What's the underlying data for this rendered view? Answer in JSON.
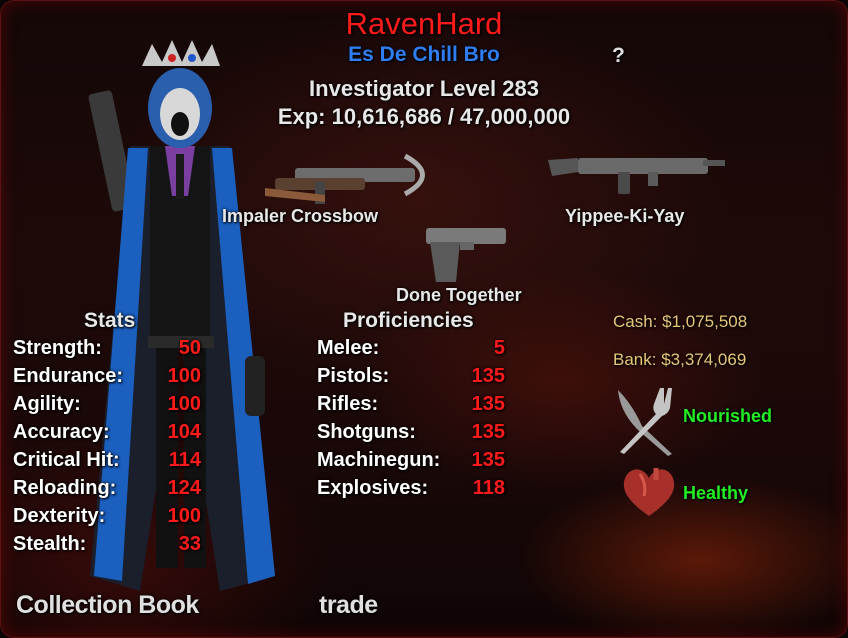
{
  "profile": {
    "name": "RavenHard",
    "title": "Es De Chill Bro",
    "level_text": "Investigator Level 283",
    "exp_text": "Exp: 10,616,686 / 47,000,000",
    "help": "?"
  },
  "weapons": {
    "primary": "Impaler Crossbow",
    "secondary": "Yippee-Ki-Yay",
    "sidearm": "Done Together"
  },
  "stats": {
    "header": "Stats",
    "rows": [
      {
        "label": "Strength:",
        "value": "50"
      },
      {
        "label": "Endurance:",
        "value": "100"
      },
      {
        "label": "Agility:",
        "value": "100"
      },
      {
        "label": "Accuracy:",
        "value": "104"
      },
      {
        "label": "Critical Hit:",
        "value": "114"
      },
      {
        "label": "Reloading:",
        "value": "124"
      },
      {
        "label": "Dexterity:",
        "value": "100"
      },
      {
        "label": "Stealth:",
        "value": "33"
      }
    ]
  },
  "proficiencies": {
    "header": "Proficiencies",
    "rows": [
      {
        "label": "Melee:",
        "value": "5"
      },
      {
        "label": "Pistols:",
        "value": "135"
      },
      {
        "label": "Rifles:",
        "value": "135"
      },
      {
        "label": "Shotguns:",
        "value": "135"
      },
      {
        "label": "Machinegun:",
        "value": "135"
      },
      {
        "label": "Explosives:",
        "value": "118"
      }
    ]
  },
  "money": {
    "cash": "Cash: $1,075,508",
    "bank": "Bank: $3,374,069"
  },
  "status": {
    "hunger": "Nourished",
    "health": "Healthy",
    "hunger_icon": "fork-knife-icon",
    "health_icon": "heart-icon"
  },
  "links": {
    "collection": "Collection Book",
    "trade": "trade"
  },
  "colors": {
    "name": "#ff1a1a",
    "title": "#2f7df2",
    "stat_value": "#ff1a1a",
    "money": "#e6c77a",
    "status": "#22ee22"
  }
}
